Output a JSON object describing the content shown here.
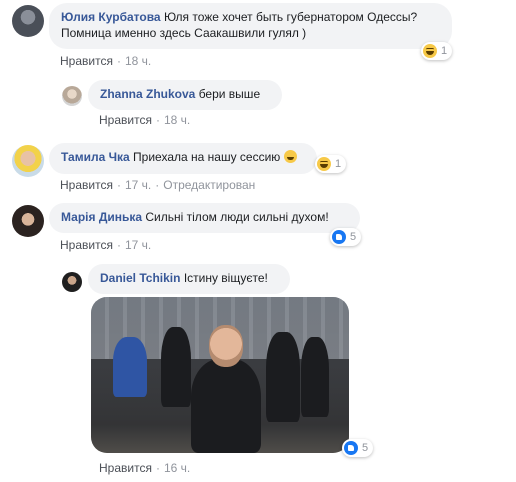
{
  "comments": [
    {
      "author": "Юлия Курбатова",
      "text_line1": "Юля тоже хочет быть губернатором Одессы?",
      "text_line2": "Помница именно здесь Саакашвили гулял )",
      "like_label": "Нравится",
      "time": "18 ч.",
      "reaction_icon": "haha-icon",
      "reaction_count": "1"
    },
    {
      "author": "Zhanna Zhukova",
      "text": "бери выше",
      "like_label": "Нравится",
      "time": "18 ч."
    },
    {
      "author": "Тамила Чка",
      "text": "Приехала на нашу сессию",
      "like_label": "Нравится",
      "time": "17 ч.",
      "edited": "Отредактирован",
      "reaction_icon": "haha-icon",
      "reaction_count": "1"
    },
    {
      "author": "Марія Динька",
      "text": "Сильні тілом люди сильні духом!",
      "like_label": "Нравится",
      "time": "17 ч.",
      "reaction_icon": "like-icon",
      "reaction_count": "5"
    },
    {
      "author": "Daniel Tchikin",
      "text": "Істину віщуєте!",
      "like_label": "Нравится",
      "time": "16 ч.",
      "reaction_icon": "like-icon",
      "reaction_count": "5"
    }
  ],
  "separator": "·",
  "colors": {
    "name": "#385898",
    "bubble": "#f2f3f5",
    "meta": "#90949c",
    "like_blue": "#1877f2",
    "haha_yellow": "#f7c948"
  }
}
